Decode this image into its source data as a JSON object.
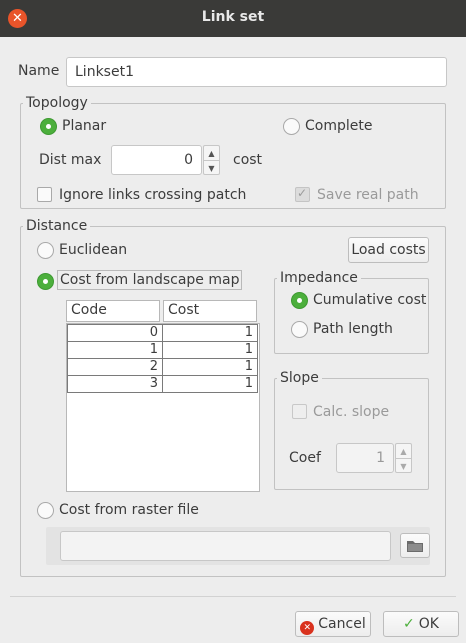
{
  "window": {
    "title": "Link set"
  },
  "name": {
    "label": "Name",
    "value": "Linkset1"
  },
  "topology": {
    "title": "Topology",
    "planar_label": "Planar",
    "complete_label": "Complete",
    "distmax_label": "Dist max",
    "distmax_value": "0",
    "distmax_unit": "cost",
    "ignore_label": "Ignore links crossing patch",
    "savepath_label": "Save real path"
  },
  "distance": {
    "title": "Distance",
    "euclidean_label": "Euclidean",
    "load_costs_label": "Load costs",
    "landscape_label": "Cost from landscape map",
    "raster_label": "Cost from raster file",
    "raster_path": "",
    "table": {
      "headers": [
        "Code",
        "Cost"
      ],
      "rows": [
        {
          "code": "0",
          "cost": "1"
        },
        {
          "code": "1",
          "cost": "1"
        },
        {
          "code": "2",
          "cost": "1"
        },
        {
          "code": "3",
          "cost": "1"
        }
      ]
    },
    "impedance": {
      "title": "Impedance",
      "cumulative_label": "Cumulative cost",
      "path_label": "Path length"
    },
    "slope": {
      "title": "Slope",
      "calc_label": "Calc. slope",
      "coef_label": "Coef",
      "coef_value": "1"
    }
  },
  "buttons": {
    "cancel_label": "Cancel",
    "ok_label": "OK"
  },
  "colors": {
    "accent": "#4caf3c",
    "close": "#e9542a",
    "titlebar": "#3a3a38"
  }
}
